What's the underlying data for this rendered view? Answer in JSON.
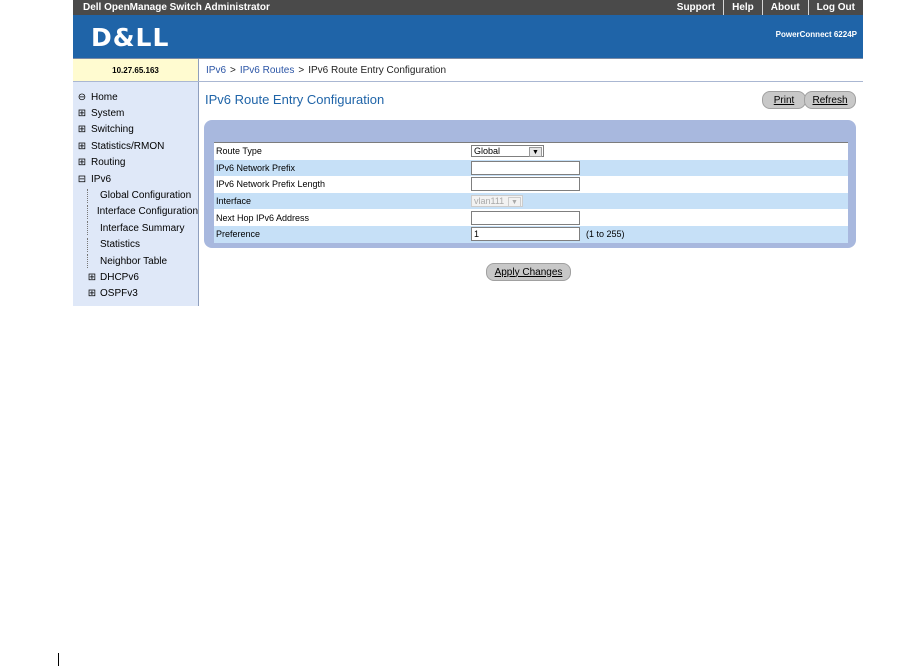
{
  "app": {
    "title": "Dell OpenManage Switch Administrator",
    "links": [
      "Support",
      "Help",
      "About",
      "Log Out"
    ],
    "logo": "D&LL",
    "product": "PowerConnect 6224P",
    "ip": "10.27.65.163"
  },
  "breadcrumb": {
    "crumbs": [
      "IPv6",
      "IPv6 Routes"
    ],
    "current": "IPv6 Route Entry Configuration"
  },
  "sidebar": {
    "items": [
      {
        "label": "Home",
        "icon": "home-icon"
      },
      {
        "label": "System",
        "icon": "plus-box-icon"
      },
      {
        "label": "Switching",
        "icon": "plus-box-icon"
      },
      {
        "label": "Statistics/RMON",
        "icon": "plus-box-icon"
      },
      {
        "label": "Routing",
        "icon": "plus-box-icon"
      },
      {
        "label": "IPv6",
        "icon": "minus-box-icon"
      },
      {
        "label": "Global Configuration"
      },
      {
        "label": "Interface Configuration"
      },
      {
        "label": "Interface Summary"
      },
      {
        "label": "Statistics"
      },
      {
        "label": "Neighbor Table"
      },
      {
        "label": "DHCPv6",
        "icon": "plus-box-icon"
      },
      {
        "label": "OSPFv3",
        "icon": "plus-box-icon"
      }
    ]
  },
  "page": {
    "title": "IPv6 Route Entry Configuration",
    "print": "Print",
    "refresh": "Refresh",
    "apply": "Apply Changes"
  },
  "form": {
    "route_type_label": "Route Type",
    "route_type_value": "Global",
    "prefix_label": "IPv6 Network Prefix",
    "prefix_value": "",
    "prefix_len_label": "IPv6 Network Prefix Length",
    "prefix_len_value": "",
    "interface_label": "Interface",
    "interface_value": "vlan111",
    "next_hop_label": "Next Hop IPv6 Address",
    "next_hop_value": "",
    "preference_label": "Preference",
    "preference_value": "1",
    "preference_hint": "(1 to 255)"
  }
}
